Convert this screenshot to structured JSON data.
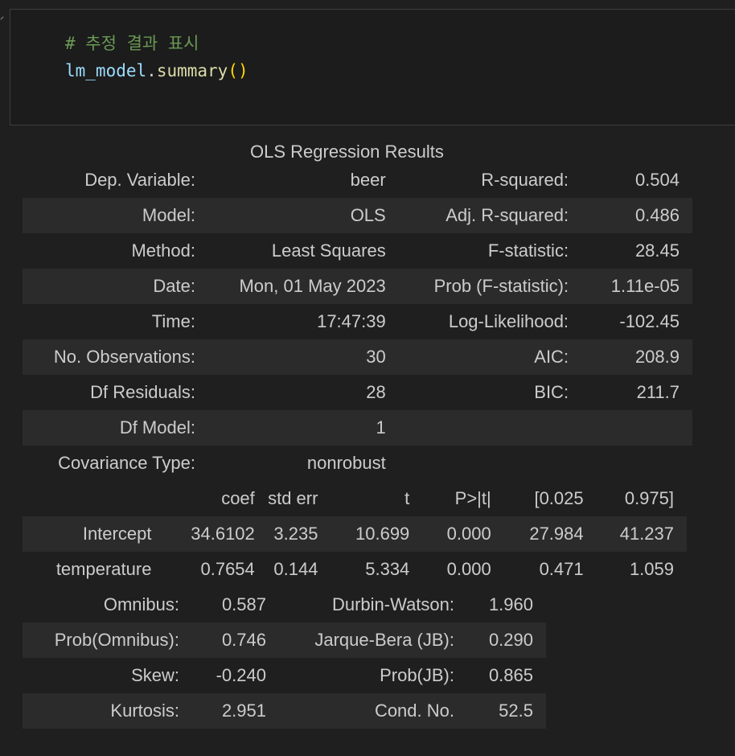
{
  "code": {
    "comment": "# 추정 결과 표시",
    "var": "lm_model",
    "dot": ".",
    "method": "summary",
    "parens": "()"
  },
  "caption": "OLS Regression Results",
  "table1": [
    [
      "Dep. Variable:",
      "beer",
      "R-squared:",
      "0.504"
    ],
    [
      "Model:",
      "OLS",
      "Adj. R-squared:",
      "0.486"
    ],
    [
      "Method:",
      "Least Squares",
      "F-statistic:",
      "28.45"
    ],
    [
      "Date:",
      "Mon, 01 May 2023",
      "Prob (F-statistic):",
      "1.11e-05"
    ],
    [
      "Time:",
      "17:47:39",
      "Log-Likelihood:",
      "-102.45"
    ],
    [
      "No. Observations:",
      "30",
      "AIC:",
      "208.9"
    ],
    [
      "Df Residuals:",
      "28",
      "BIC:",
      "211.7"
    ],
    [
      "Df Model:",
      "1",
      "",
      ""
    ],
    [
      "Covariance Type:",
      "nonrobust",
      "",
      ""
    ]
  ],
  "table2_header": [
    "",
    "coef",
    "std err",
    "t",
    "P>|t|",
    "[0.025",
    "0.975]"
  ],
  "table2_rows": [
    [
      "Intercept",
      "34.6102",
      "3.235",
      "10.699",
      "0.000",
      "27.984",
      "41.237"
    ],
    [
      "temperature",
      "0.7654",
      "0.144",
      "5.334",
      "0.000",
      "0.471",
      "1.059"
    ]
  ],
  "table3": [
    [
      "Omnibus:",
      "0.587",
      "Durbin-Watson:",
      "1.960"
    ],
    [
      "Prob(Omnibus):",
      "0.746",
      "Jarque-Bera (JB):",
      "0.290"
    ],
    [
      "Skew:",
      "-0.240",
      "Prob(JB):",
      "0.865"
    ],
    [
      "Kurtosis:",
      "2.951",
      "Cond. No.",
      "52.5"
    ]
  ]
}
